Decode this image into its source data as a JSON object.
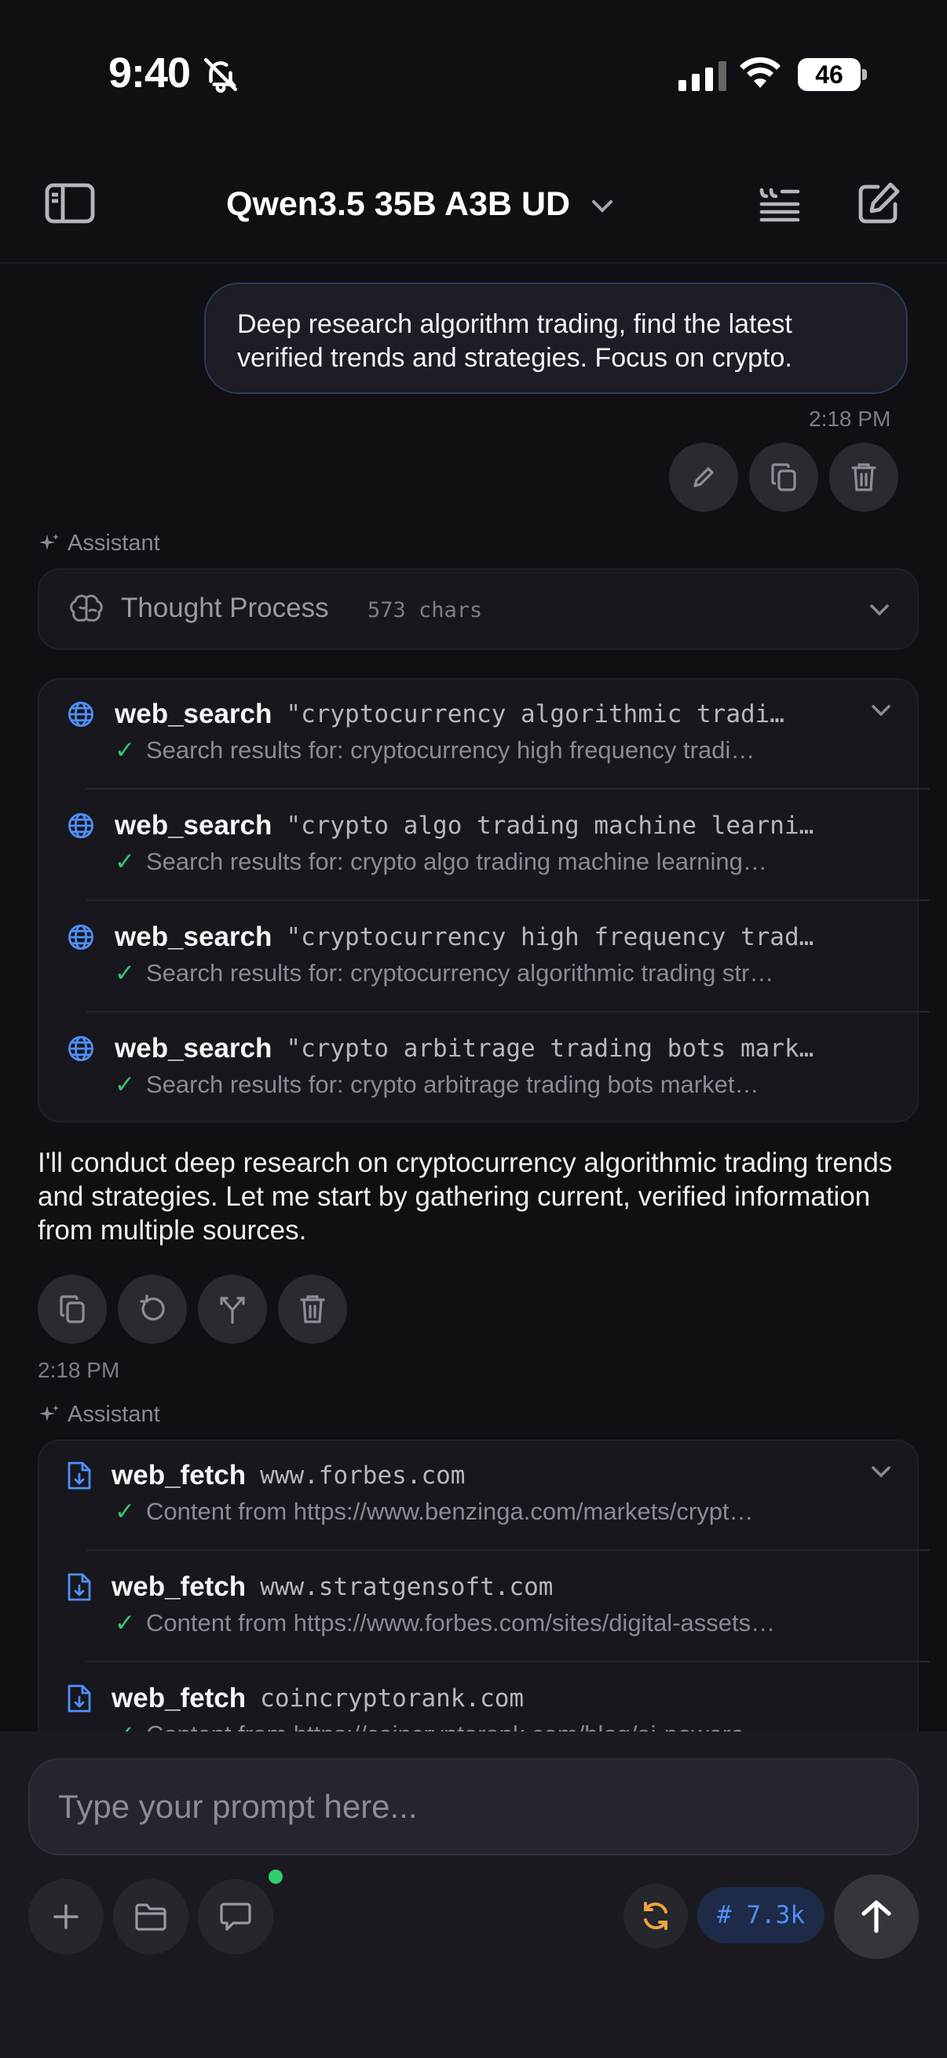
{
  "status_bar": {
    "time": "9:40",
    "battery": "46"
  },
  "header": {
    "model_name": "Qwen3.5 35B A3B UD"
  },
  "user_message": {
    "text": "Deep research algorithm trading, find the latest verified trends and strategies. Focus on crypto.",
    "time": "2:18 PM"
  },
  "assistant_label": "Assistant",
  "thought": {
    "label": "Thought Process",
    "count": "573 chars"
  },
  "search_calls": [
    {
      "tool": "web_search",
      "query": "\"cryptocurrency algorithmic tradi…",
      "result": "Search results for: cryptocurrency high frequency tradi…"
    },
    {
      "tool": "web_search",
      "query": "\"crypto algo trading machine learni…",
      "result": "Search results for: crypto algo trading machine learning…"
    },
    {
      "tool": "web_search",
      "query": "\"cryptocurrency high frequency trad…",
      "result": "Search results for: cryptocurrency algorithmic trading str…"
    },
    {
      "tool": "web_search",
      "query": "\"crypto arbitrage trading bots mark…",
      "result": "Search results for: crypto arbitrage trading bots market…"
    }
  ],
  "assistant_reply": "I'll conduct deep research on cryptocurrency algorithmic trading trends and strategies. Let me start by gathering current, verified information from multiple sources.",
  "reply_time": "2:18 PM",
  "fetch_calls": [
    {
      "tool": "web_fetch",
      "domain": "www.forbes.com",
      "result": "Content from https://www.benzinga.com/markets/crypt…"
    },
    {
      "tool": "web_fetch",
      "domain": "www.stratgensoft.com",
      "result": "Content from https://www.forbes.com/sites/digital-assets…"
    },
    {
      "tool": "web_fetch",
      "domain": "coincryptorank.com",
      "result": "Content from https://coincryptorank.com/blog/ai-powere…"
    }
  ],
  "composer": {
    "placeholder": "Type your prompt here...",
    "token_count": "# 7.3k"
  },
  "colors": {
    "accent_blue": "#4f8ff7",
    "success_green": "#38c56d",
    "status_dot": "#2ed06a",
    "sync_orange": "#f0a43a"
  }
}
